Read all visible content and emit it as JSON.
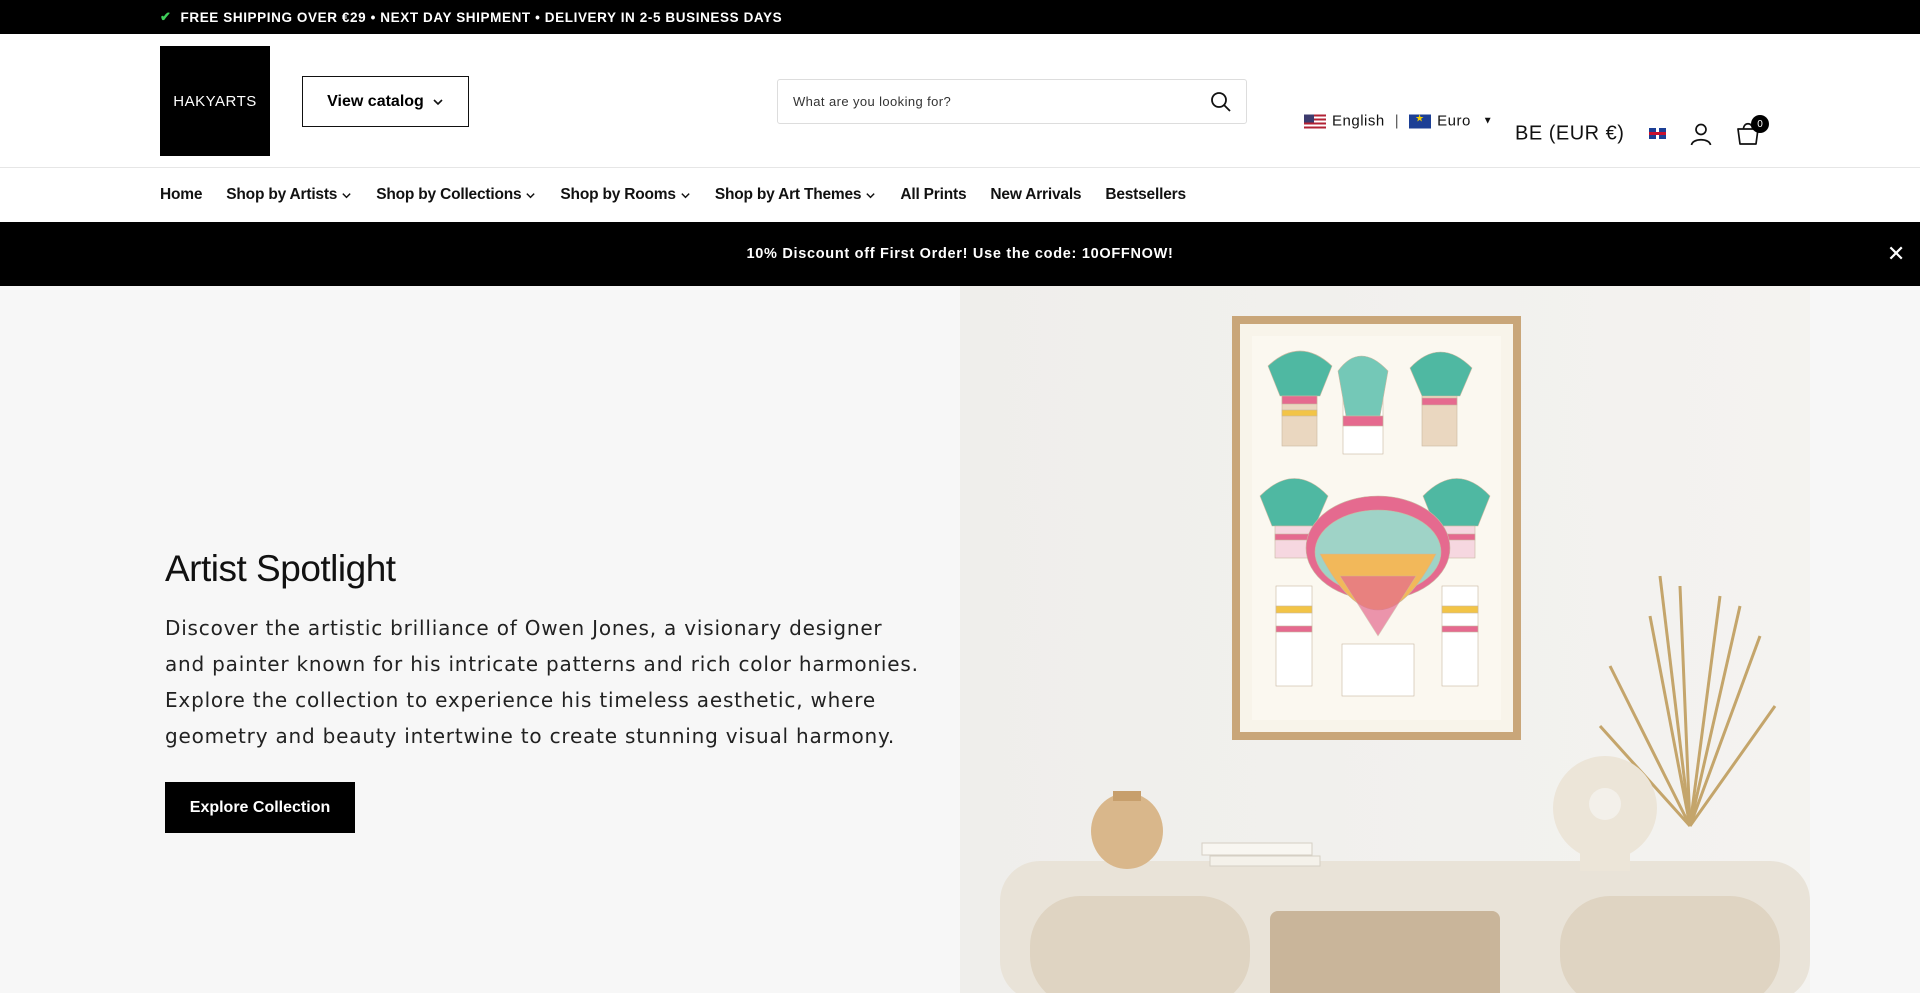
{
  "topbar": {
    "text": "FREE SHIPPING OVER €29 • NEXT DAY SHIPMENT • DELIVERY IN 2-5 BUSINESS DAYS"
  },
  "header": {
    "logo": "HAKYARTS",
    "catalog_label": "View catalog",
    "search_placeholder": "What are you looking for?",
    "language": "English",
    "currency": "Euro",
    "region": "BE (EUR €)",
    "cart_count": "0"
  },
  "nav": {
    "items": [
      {
        "label": "Home",
        "dropdown": false
      },
      {
        "label": "Shop by Artists",
        "dropdown": true
      },
      {
        "label": "Shop by Collections",
        "dropdown": true
      },
      {
        "label": "Shop by Rooms",
        "dropdown": true
      },
      {
        "label": "Shop by Art Themes",
        "dropdown": true
      },
      {
        "label": "All Prints",
        "dropdown": false
      },
      {
        "label": "New Arrivals",
        "dropdown": false
      },
      {
        "label": "Bestsellers",
        "dropdown": false
      }
    ]
  },
  "promo": {
    "text": "10% Discount off First Order! Use the code: 10OFFNOW!"
  },
  "hero": {
    "title": "Artist Spotlight",
    "description": "Discover the artistic brilliance of Owen Jones, a visionary designer and painter known for his intricate patterns and rich color harmonies. Explore the collection to experience his timeless aesthetic, where geometry and beauty intertwine to create stunning visual harmony.",
    "button_label": "Explore Collection"
  },
  "colors": {
    "primary": "#000000",
    "background": "#f7f7f7",
    "accent_check": "#3ecf5a"
  }
}
